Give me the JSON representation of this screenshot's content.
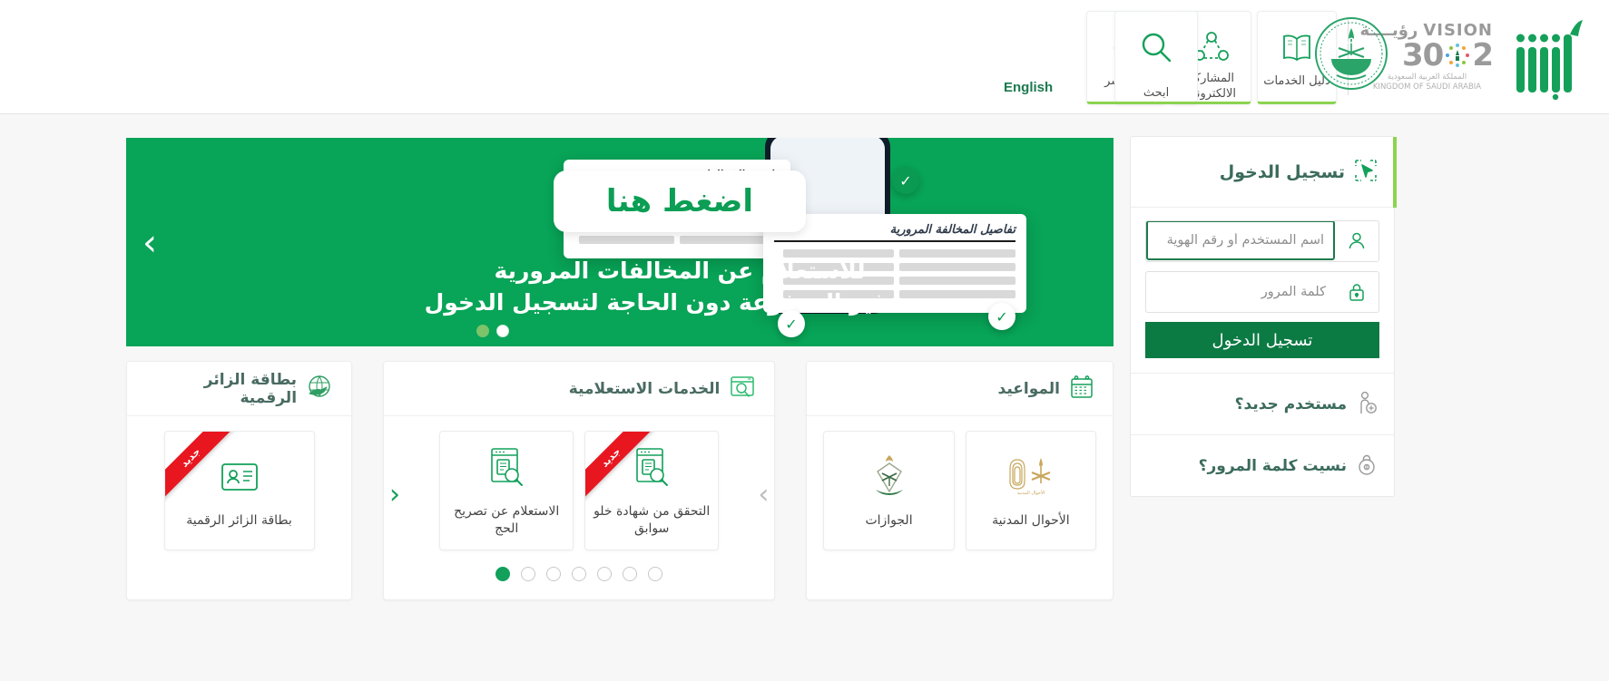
{
  "header": {
    "search_tile": {
      "label": "ابحث",
      "icon": "search-icon"
    },
    "language_switch": "English",
    "nav_tiles": [
      {
        "label": "دليل الخدمات",
        "icon": "book-icon"
      },
      {
        "label": "المشاركة الالكترونية",
        "icon": "participation-icon"
      },
      {
        "label": "عن أبشر",
        "icon": "about-cursor-icon"
      }
    ],
    "vision": {
      "word_ar": "رؤيــــة",
      "word_en": "VISION",
      "year_left": "2",
      "year_right": "30",
      "country_ar": "المملكة العربية السعودية",
      "country_en": "KINGDOM OF SAUDI ARABIA"
    },
    "brand_name": "أبشر",
    "moi_emblem_label": "moi-emblem"
  },
  "login": {
    "title": "تسجيل الدخول",
    "title_icon": "login-cursor-icon",
    "username": {
      "placeholder": "اسم المستخدم أو رقم الهوية",
      "value": "",
      "icon": "user-icon"
    },
    "password": {
      "placeholder": "كلمة المرور",
      "value": "",
      "icon": "lock-icon"
    },
    "submit_label": "تسجيل الدخول",
    "new_user_label": "مستخدم جديد؟",
    "new_user_icon": "add-user-icon",
    "forgot_password_label": "نسيت كلمة المرور؟",
    "forgot_password_icon": "lock-key-icon",
    "accent_color": "#8bd44f",
    "button_color": "#0b7a43"
  },
  "hero": {
    "cta_label": "اضغط هنا",
    "line1": "للاستعلام عن المخالفات المرورية",
    "line2": "غير المدفوعة دون الحاجة لتسجيل الدخول",
    "next_arrow": "›",
    "dots": [
      false,
      true
    ],
    "background_color": "#08a457",
    "art": {
      "sheet1_title": "ملخص المخالفات",
      "sheet2_title": "تفاصيل المخالفة المرورية",
      "check_glyph": "✓"
    }
  },
  "panels": [
    {
      "key": "appointments",
      "title": "المواعيد",
      "icon": "calendar-icon",
      "tiles": [
        {
          "label": "الأحوال المدنية",
          "icon": "civil-affairs-icon",
          "badge": ""
        },
        {
          "label": "الجوازات",
          "icon": "passports-icon",
          "badge": ""
        }
      ]
    },
    {
      "key": "inquiry",
      "title": "الخدمات الاستعلامية",
      "icon": "inquiry-search-icon",
      "tiles": [
        {
          "label": "التحقق من شهادة خلو سوابق",
          "icon": "document-search-icon",
          "badge": "جديد"
        },
        {
          "label": "الاستعلام عن تصريح الحج",
          "icon": "document-search-icon",
          "badge": ""
        }
      ],
      "arrow_next": "›",
      "arrow_prev": "‹",
      "pager": [
        false,
        false,
        false,
        false,
        false,
        false,
        true
      ]
    },
    {
      "key": "visitor",
      "title": "بطاقة الزائر الرقمية",
      "icon": "globe-plane-icon",
      "tiles": [
        {
          "label": "بطاقة الزائر الرقمية",
          "icon": "id-card-icon",
          "badge": "جديد"
        }
      ]
    }
  ]
}
